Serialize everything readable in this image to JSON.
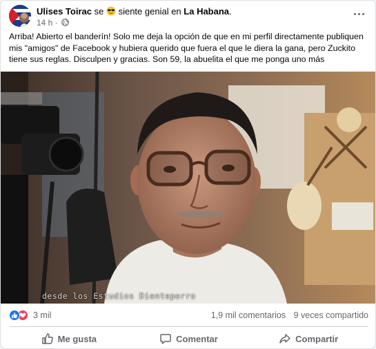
{
  "post": {
    "author": "Ulises Toirac",
    "feeling_prefix": "se",
    "feeling_emoji": "sunglasses-face-icon",
    "feeling_text": "siente genial en",
    "location": "La Habana",
    "location_suffix": ".",
    "time": "14 h",
    "time_separator": "·",
    "privacy_icon": "globe-icon",
    "body": "Arriba! Abierto el banderín! Solo me deja la opción de que en mi perfil directamente publiquen mis \"amigos\" de Facebook y hubiera querido que fuera el que le diera la gana, pero Zuckito tiene sus reglas. Disculpen y gracias. Son 59, la abuelita el que me ponga uno más",
    "image_watermark": "desde los Estudios Dienteperro"
  },
  "stats": {
    "reaction_icons": [
      "like-icon",
      "love-icon"
    ],
    "reactions_count": "3 mil",
    "comments": "1,9 mil comentarios",
    "shares": "9 veces compartido"
  },
  "actions": {
    "like": "Me gusta",
    "comment": "Comentar",
    "share": "Compartir"
  },
  "colors": {
    "like_blue": "#1877f2",
    "love_red": "#f33e58",
    "secondary_text": "#65676b"
  }
}
